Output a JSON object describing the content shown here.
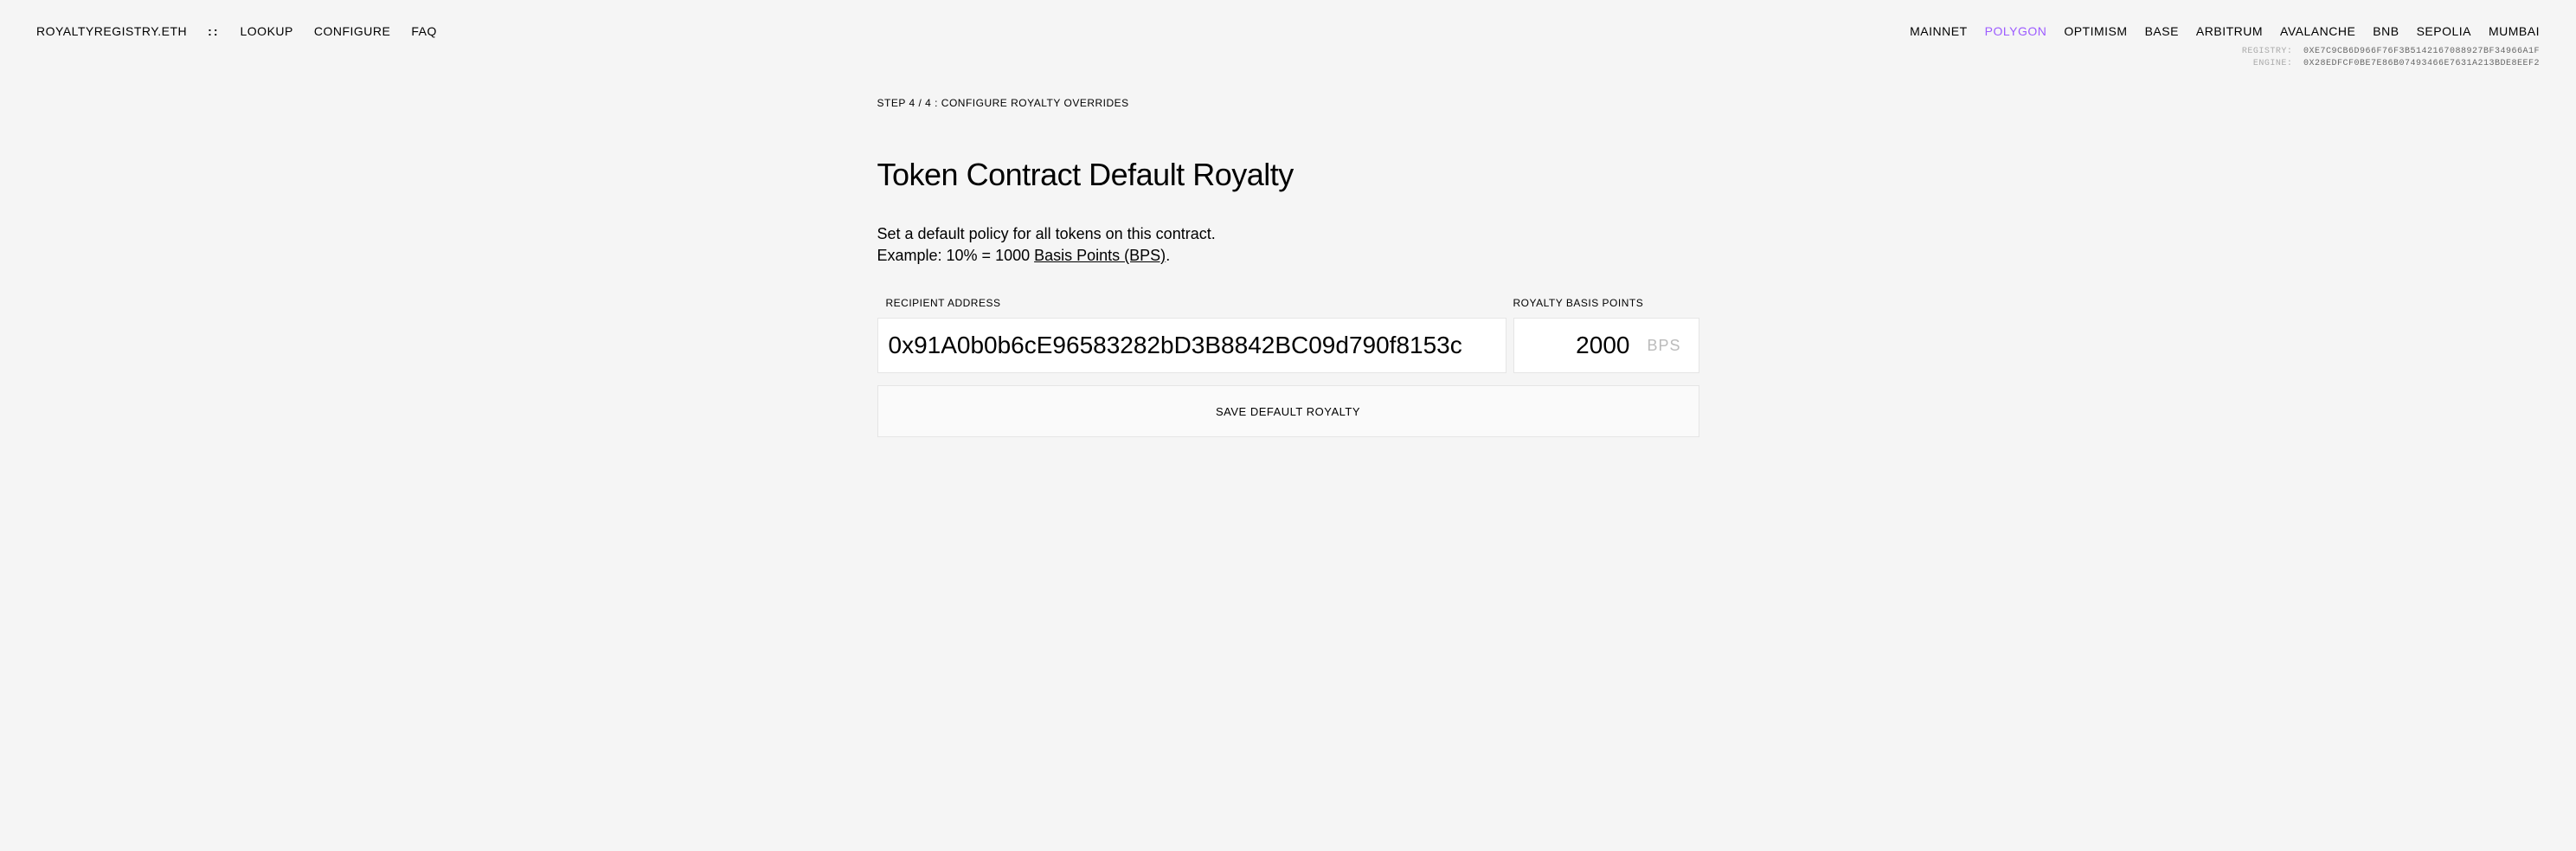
{
  "header": {
    "logo": "ROYALTYREGISTRY.ETH",
    "dots": "::",
    "navLeft": [
      {
        "label": "LOOKUP"
      },
      {
        "label": "CONFIGURE"
      },
      {
        "label": "FAQ"
      }
    ],
    "networks": [
      {
        "label": "MAINNET",
        "active": false
      },
      {
        "label": "POLYGON",
        "active": true
      },
      {
        "label": "OPTIMISM",
        "active": false
      },
      {
        "label": "BASE",
        "active": false
      },
      {
        "label": "ARBITRUM",
        "active": false
      },
      {
        "label": "AVALANCHE",
        "active": false
      },
      {
        "label": "BNB",
        "active": false
      },
      {
        "label": "SEPOLIA",
        "active": false
      },
      {
        "label": "MUMBAI",
        "active": false
      }
    ]
  },
  "addresses": {
    "registry": {
      "label": "REGISTRY:",
      "value": "0XE7C9CB6D966F76F3B5142167088927BF34966A1F"
    },
    "engine": {
      "label": "ENGINE:",
      "value": "0X28EDFCF0BE7E86B07493466E7631A213BDE8EEF2"
    }
  },
  "main": {
    "step": "STEP 4 / 4 : CONFIGURE ROYALTY OVERRIDES",
    "title": "Token Contract Default Royalty",
    "description1": "Set a default policy for all tokens on this contract.",
    "description2a": "Example: 10% = 1000 ",
    "description2b": "Basis Points (BPS)",
    "description2c": ".",
    "form": {
      "addressLabel": "RECIPIENT ADDRESS",
      "addressValue": "0x91A0b0b6cE96583282bD3B8842BC09d790f8153c",
      "bpsLabel": "ROYALTY BASIS POINTS",
      "bpsValue": "2000",
      "bpsSuffix": "BPS",
      "saveLabel": "SAVE DEFAULT ROYALTY"
    }
  }
}
